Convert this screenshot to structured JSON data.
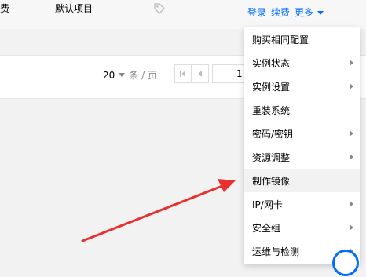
{
  "header_row": {
    "col1_text": "费",
    "col2_text": "默认项目",
    "tag_icon": "tag-icon",
    "actions": {
      "login": "登录",
      "renew": "续费",
      "more": "更多"
    }
  },
  "pagination": {
    "page_size": "20",
    "page_size_unit": "条 / 页",
    "current_page": "1"
  },
  "more_menu": {
    "items": [
      {
        "label": "购买相同配置",
        "has_submenu": false
      },
      {
        "label": "实例状态",
        "has_submenu": true
      },
      {
        "label": "实例设置",
        "has_submenu": true
      },
      {
        "label": "重装系统",
        "has_submenu": false
      },
      {
        "label": "密码/密钥",
        "has_submenu": true
      },
      {
        "label": "资源调整",
        "has_submenu": true
      },
      {
        "label": "制作镜像",
        "has_submenu": false,
        "highlighted": true
      },
      {
        "label": "IP/网卡",
        "has_submenu": true
      },
      {
        "label": "安全组",
        "has_submenu": true
      },
      {
        "label": "运维与检测",
        "has_submenu": true
      }
    ]
  },
  "colors": {
    "link": "#006eff",
    "annotation_arrow": "#e8312f",
    "menu_hover": "#f2f2f2"
  }
}
